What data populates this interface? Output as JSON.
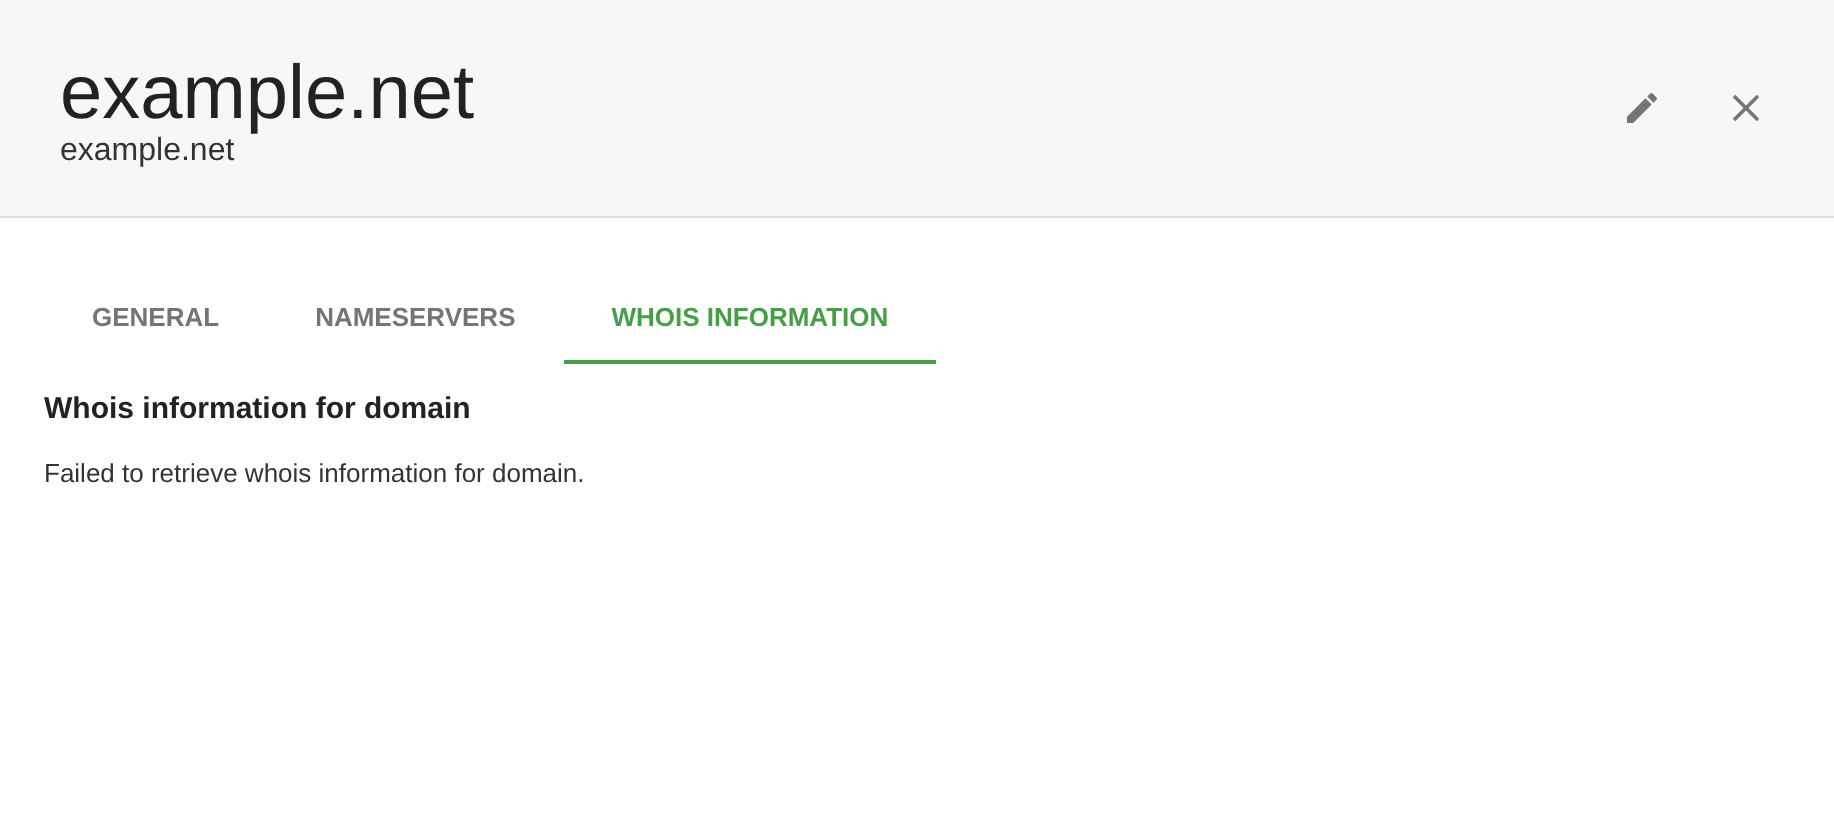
{
  "header": {
    "title": "example.net",
    "subtitle": "example.net"
  },
  "tabs": [
    {
      "label": "GENERAL",
      "selected": false
    },
    {
      "label": "NAMESERVERS",
      "selected": false
    },
    {
      "label": "WHOIS INFORMATION",
      "selected": true
    }
  ],
  "section": {
    "heading": "Whois information for domain",
    "message": "Failed to retrieve whois information for domain."
  }
}
